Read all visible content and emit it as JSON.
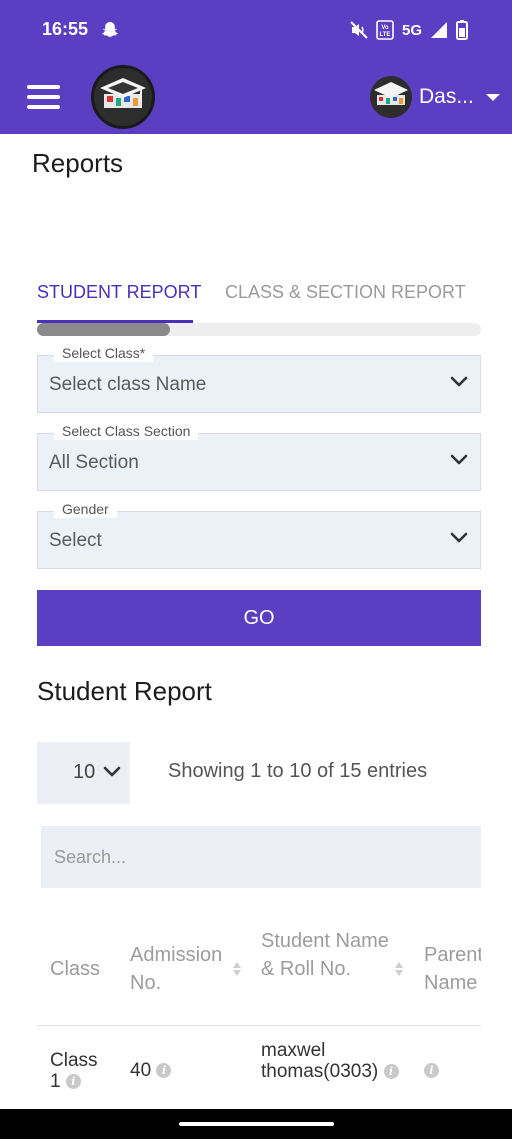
{
  "status_bar": {
    "time": "16:55",
    "network": "5G",
    "volte": "Vo LTE"
  },
  "app_bar": {
    "user_label": "Das..."
  },
  "page": {
    "title": "Reports"
  },
  "tabs": [
    {
      "label": "STUDENT REPORT",
      "active": true
    },
    {
      "label": "CLASS & SECTION REPORT",
      "active": false
    }
  ],
  "filters": {
    "class": {
      "label": "Select Class*",
      "value": "Select class Name"
    },
    "section": {
      "label": "Select Class Section",
      "value": "All Section"
    },
    "gender": {
      "label": "Gender",
      "value": "Select"
    }
  },
  "go_button": "GO",
  "report": {
    "title": "Student Report",
    "page_length": "10",
    "showing": "Showing 1 to 10 of 15 entries",
    "search_placeholder": "Search...",
    "columns": [
      "Class",
      "Admission No.",
      "Student Name & Roll No.",
      "Parent Name"
    ],
    "rows": [
      {
        "class": "Class 1",
        "admission_no": "40",
        "student": "maxwel thomas(0303)"
      }
    ]
  },
  "colors": {
    "primary": "#5b3fc3",
    "active_tab": "#4a2fbd"
  }
}
